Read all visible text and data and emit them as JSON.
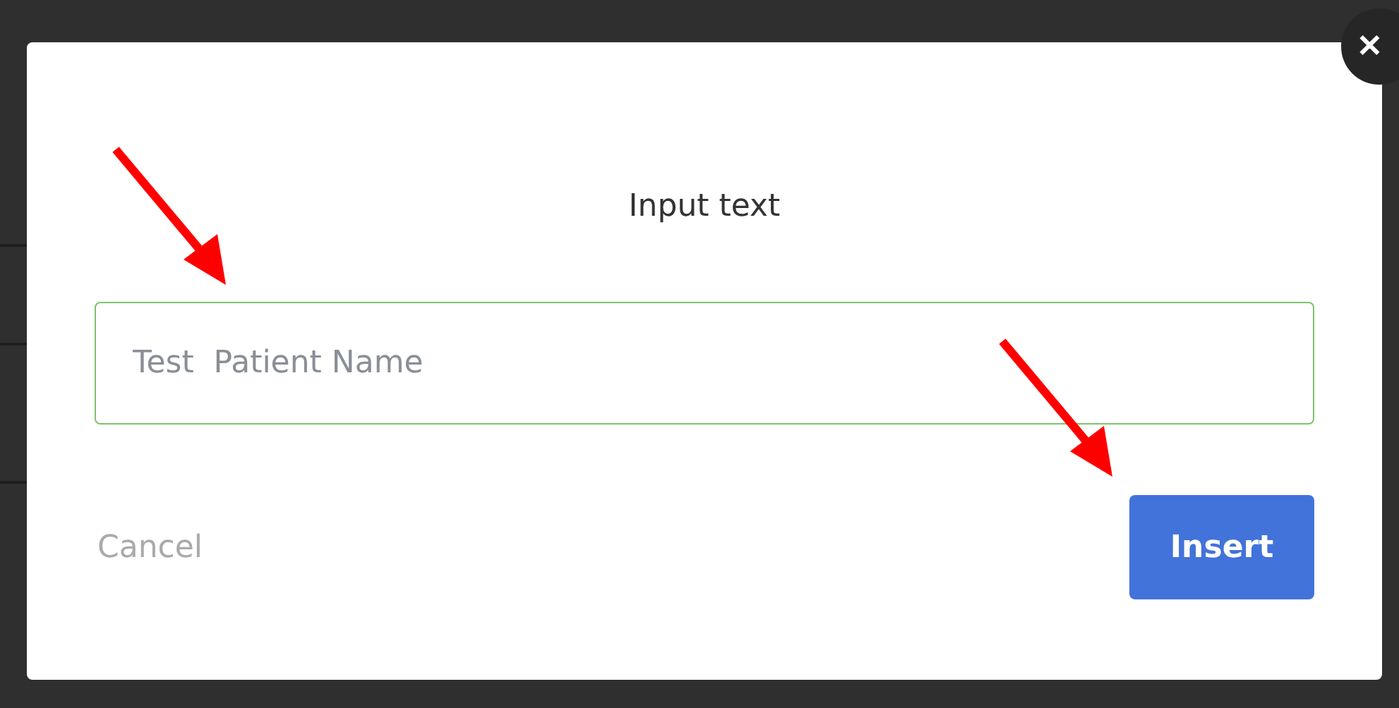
{
  "dialog": {
    "title": "Input text",
    "field": {
      "value": "Test  Patient Name"
    },
    "buttons": [
      {
        "label": "Cancel",
        "kind": "secondary"
      },
      {
        "label": "Insert",
        "kind": "primary"
      }
    ],
    "close": {
      "label": "✕"
    }
  }
}
